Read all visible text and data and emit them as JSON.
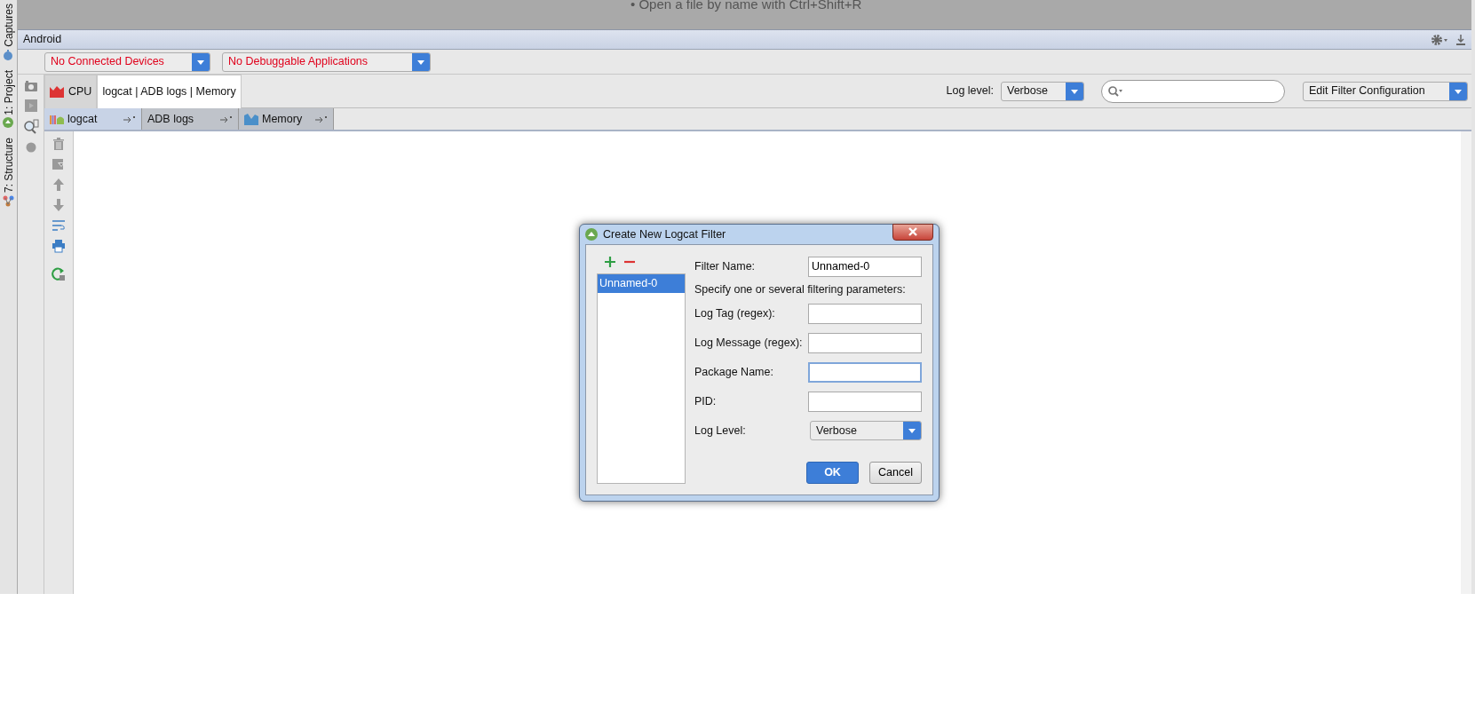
{
  "background_hints": [
    "• Open a file by name with Ctrl+Shift+R"
  ],
  "left_tool_tabs": [
    {
      "label": "Captures",
      "kind": "captures"
    },
    {
      "label": "1: Project",
      "kind": "project"
    },
    {
      "label": "7: Structure",
      "kind": "structure"
    }
  ],
  "panel": {
    "title": "Android"
  },
  "device_select": {
    "value": "No Connected Devices"
  },
  "app_select": {
    "value": "No Debuggable Applications"
  },
  "monitor_tabs": [
    {
      "label": "CPU",
      "selected": false,
      "kind": "cpu"
    },
    {
      "label": "logcat | ADB logs | Memory",
      "selected": true,
      "kind": "plain"
    }
  ],
  "log_level": {
    "label": "Log level:",
    "value": "Verbose"
  },
  "filter_select": {
    "value": "Edit Filter Configuration"
  },
  "sub_tabs": [
    {
      "label": "logcat",
      "selected": true,
      "kind": "logcat"
    },
    {
      "label": "ADB logs",
      "selected": false,
      "kind": "plain"
    },
    {
      "label": "Memory",
      "selected": false,
      "kind": "memory"
    }
  ],
  "dialog": {
    "title": "Create New Logcat Filter",
    "filters": [
      {
        "label": "Unnamed-0",
        "selected": true
      }
    ],
    "fields": [
      {
        "kind": "text",
        "label": "Filter Name:",
        "value": "Unnamed-0",
        "focused": false
      },
      {
        "kind": "note",
        "label": "Specify one or several filtering parameters:"
      },
      {
        "kind": "text",
        "label": "Log Tag (regex):",
        "focused": false
      },
      {
        "kind": "text",
        "label": "Log Message (regex):",
        "focused": false
      },
      {
        "kind": "text",
        "label": "Package Name:",
        "focused": true
      },
      {
        "kind": "text",
        "label": "PID:",
        "focused": false
      },
      {
        "kind": "select",
        "label": "Log Level:",
        "value": "Verbose"
      }
    ],
    "buttons": [
      {
        "label": "OK",
        "kind": "primary"
      },
      {
        "label": "Cancel",
        "kind": "secondary"
      }
    ]
  }
}
